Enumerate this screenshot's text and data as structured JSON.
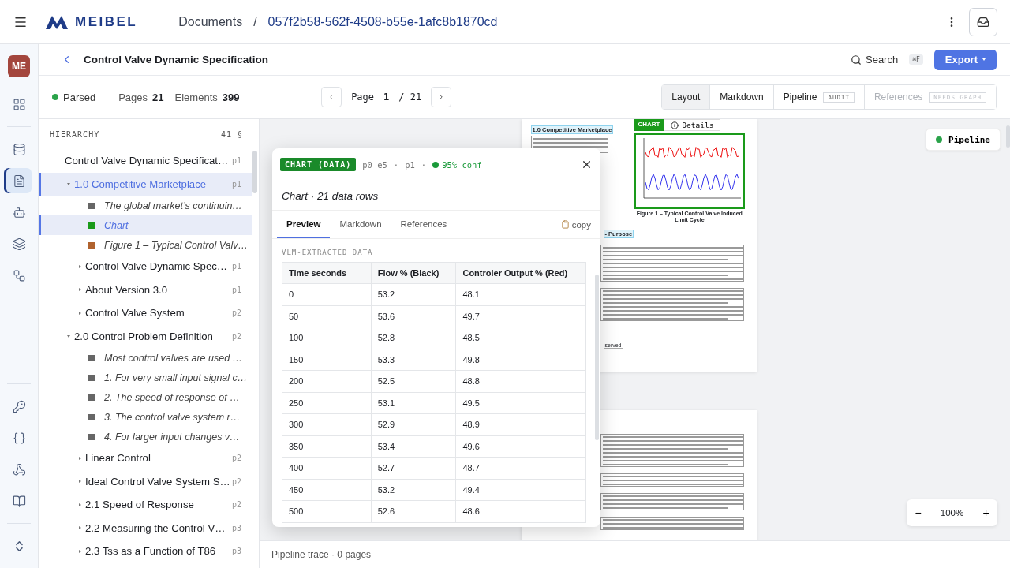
{
  "app": {
    "logo": "MEIBEL",
    "breadcrumb": [
      "Documents",
      "057f2b58-562f-4508-b55e-1afc8b1870cd"
    ],
    "breadcrumb_separator": "/",
    "avatar": "ME"
  },
  "rail": {
    "top": [
      {
        "selected": false
      }
    ],
    "middle": [
      {
        "selected": false
      },
      {
        "selected": true
      },
      {
        "selected": false
      },
      {
        "selected": false
      },
      {
        "selected": false
      }
    ],
    "bottom": [
      {
        "selected": false
      },
      {
        "selected": false
      },
      {
        "selected": false
      },
      {
        "selected": false
      }
    ]
  },
  "header": {
    "title": "Control Valve Dynamic Specification",
    "search": "Search",
    "shortcut": "⌘F",
    "export": "Export"
  },
  "toolbar": {
    "status": "Parsed",
    "pages_label": "Pages",
    "pages": "21",
    "elements_label": "Elements",
    "elements": "399",
    "page_label": "Page",
    "page": "1",
    "page_total": "/ 21",
    "views": [
      {
        "label": "Layout",
        "selected": true,
        "disabled": false
      },
      {
        "label": "Markdown",
        "selected": false,
        "disabled": false
      },
      {
        "label": "Pipeline",
        "badge": "AUDIT",
        "selected": false,
        "disabled": false
      },
      {
        "label": "References",
        "badge": "NEEDS GRAPH",
        "selected": false,
        "disabled": true
      }
    ]
  },
  "hierarchy": {
    "title": "HIERARCHY",
    "count": "41 §",
    "tree": [
      {
        "kind": "section",
        "title": "Control Valve Dynamic Specificat…",
        "page": "p1",
        "selected": false,
        "children": [
          {
            "kind": "section",
            "title": "1.0 Competitive Marketplace",
            "page": "p1",
            "selected": true,
            "expanded": true,
            "children": [
              {
                "kind": "element",
                "title": "The global market’s continuin…",
                "color": "#666666",
                "selected": false
              },
              {
                "kind": "element",
                "title": "Chart",
                "color": "#1a9a1a",
                "selected": true
              },
              {
                "kind": "element",
                "title": "Figure 1 – Typical Control Valv…",
                "color": "#b0622e",
                "selected": false
              },
              {
                "kind": "section",
                "title": "Control Valve Dynamic Spec…",
                "page": "p1",
                "selected": false,
                "expanded": false
              },
              {
                "kind": "section",
                "title": "About Version 3.0",
                "page": "p1",
                "selected": false,
                "expanded": false
              },
              {
                "kind": "section",
                "title": "Control Valve System",
                "page": "p2",
                "selected": false,
                "expanded": false
              }
            ]
          },
          {
            "kind": "section",
            "title": "2.0 Control Problem Definition",
            "page": "p2",
            "selected": false,
            "expanded": true,
            "children": [
              {
                "kind": "element",
                "title": "Most control valves are used …",
                "color": "#666666",
                "selected": false
              },
              {
                "kind": "element",
                "title": "1. For very small input signal c…",
                "color": "#666666",
                "selected": false
              },
              {
                "kind": "element",
                "title": "2. The speed of response of …",
                "color": "#666666",
                "selected": false
              },
              {
                "kind": "element",
                "title": "3. The control valve system r…",
                "color": "#666666",
                "selected": false
              },
              {
                "kind": "element",
                "title": "4. For larger input changes v…",
                "color": "#666666",
                "selected": false
              },
              {
                "kind": "section",
                "title": "Linear Control",
                "page": "p2",
                "selected": false,
                "expanded": false
              },
              {
                "kind": "section",
                "title": "Ideal Control Valve System S…",
                "page": "p2",
                "selected": false,
                "expanded": false
              },
              {
                "kind": "section",
                "title": "2.1 Speed of Response",
                "page": "p2",
                "selected": false,
                "expanded": false
              },
              {
                "kind": "section",
                "title": "2.2 Measuring the Control V…",
                "page": "p3",
                "selected": false,
                "expanded": false
              },
              {
                "kind": "section",
                "title": "2.3 Tss as a Function of T86",
                "page": "p3",
                "selected": false,
                "expanded": false
              }
            ]
          }
        ]
      }
    ]
  },
  "document": {
    "heading": "1.0 Competitive Marketplace",
    "chart_badge": "CHART",
    "details": "Details",
    "caption": "Figure 1 – Typical Control Valve Induced Limit Cycle",
    "purpose": "- Purpose",
    "fragment": "served"
  },
  "popup": {
    "badge": "CHART (DATA)",
    "id": "p0_e5",
    "separator": "·",
    "page": "p1",
    "conf": "95% conf",
    "summary": "Chart · 21 data rows",
    "tabs": [
      {
        "label": "Preview",
        "selected": true
      },
      {
        "label": "Markdown",
        "selected": false
      },
      {
        "label": "References",
        "selected": false
      }
    ],
    "copy": "copy",
    "section": "VLM-EXTRACTED DATA",
    "columns": [
      "Time seconds",
      "Flow % (Black)",
      "Controler Output % (Red)"
    ],
    "rows": [
      [
        "0",
        "53.2",
        "48.1"
      ],
      [
        "50",
        "53.6",
        "49.7"
      ],
      [
        "100",
        "52.8",
        "48.5"
      ],
      [
        "150",
        "53.3",
        "49.8"
      ],
      [
        "200",
        "52.5",
        "48.8"
      ],
      [
        "250",
        "53.1",
        "49.5"
      ],
      [
        "300",
        "52.9",
        "48.9"
      ],
      [
        "350",
        "53.4",
        "49.6"
      ],
      [
        "400",
        "52.7",
        "48.7"
      ],
      [
        "450",
        "53.2",
        "49.4"
      ],
      [
        "500",
        "52.6",
        "48.6"
      ]
    ]
  },
  "pipeline": {
    "label": "Pipeline"
  },
  "zoom": {
    "minus": "−",
    "value": "100%",
    "plus": "+"
  },
  "footer": {
    "trace": "Pipeline trace · 0 pages"
  }
}
